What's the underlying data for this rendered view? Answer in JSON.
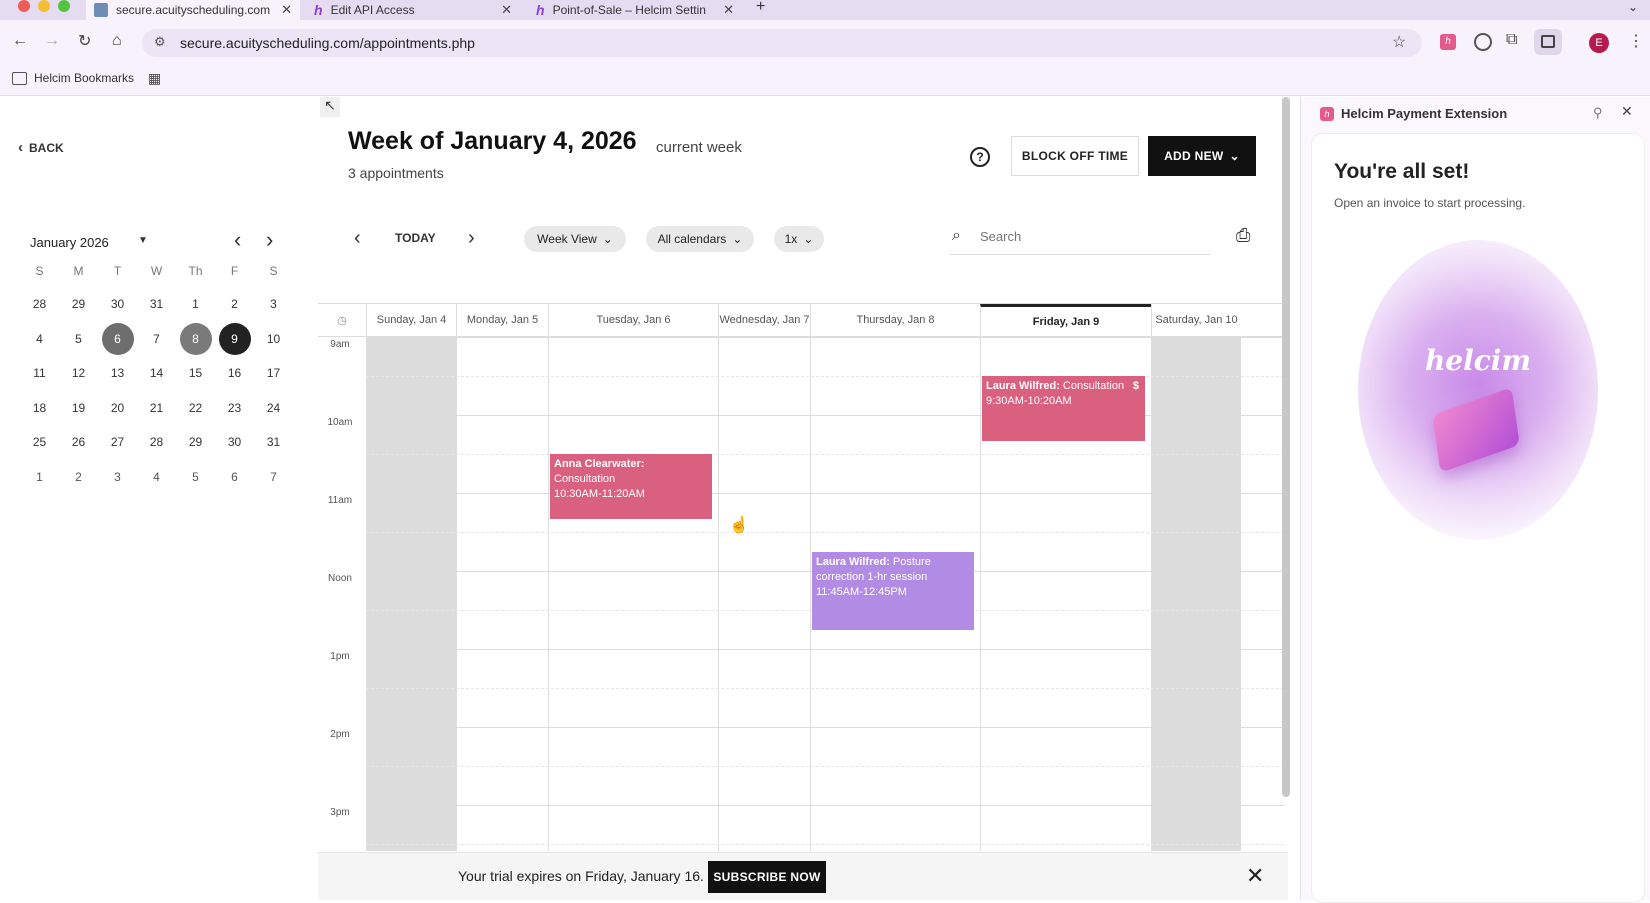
{
  "browser": {
    "tabs": [
      {
        "title": "secure.acuityscheduling.com",
        "active": true
      },
      {
        "title": "Edit API Access",
        "active": false
      },
      {
        "title": "Point-of-Sale – Helcim Settin",
        "active": false
      }
    ],
    "url": "secure.acuityscheduling.com/appointments.php",
    "bookmarks": [
      {
        "label": "Helcim Bookmarks"
      }
    ],
    "profile_initial": "E"
  },
  "leftpane": {
    "back_label": "BACK",
    "month_label": "January 2026",
    "weekdays": [
      "S",
      "M",
      "T",
      "W",
      "Th",
      "F",
      "S"
    ],
    "weeks": [
      [
        "28",
        "29",
        "30",
        "31",
        "1",
        "2",
        "3"
      ],
      [
        "4",
        "5",
        "6",
        "7",
        "8",
        "9",
        "10"
      ],
      [
        "11",
        "12",
        "13",
        "14",
        "15",
        "16",
        "17"
      ],
      [
        "18",
        "19",
        "20",
        "21",
        "22",
        "23",
        "24"
      ],
      [
        "25",
        "26",
        "27",
        "28",
        "29",
        "30",
        "31"
      ],
      [
        "1",
        "2",
        "3",
        "4",
        "5",
        "6",
        "7"
      ]
    ]
  },
  "header": {
    "title": "Week of January 4, 2026",
    "subtitle_tag": "current week",
    "appt_count": "3 appointments",
    "block_off": "BLOCK OFF TIME",
    "add_new": "ADD NEW"
  },
  "toolbar": {
    "today": "TODAY",
    "view": "Week View",
    "calendars": "All calendars",
    "zoom": "1x",
    "search_placeholder": "Search"
  },
  "calendar": {
    "days": [
      {
        "label": "Sunday, Jan 4",
        "shaded": true
      },
      {
        "label": "Monday, Jan 5",
        "shaded": false
      },
      {
        "label": "Tuesday, Jan 6",
        "shaded": false
      },
      {
        "label": "Wednesday, Jan 7",
        "shaded": false
      },
      {
        "label": "Thursday, Jan 8",
        "shaded": false
      },
      {
        "label": "Friday, Jan 9",
        "shaded": false,
        "current": true
      },
      {
        "label": "Saturday, Jan 10",
        "shaded": true
      }
    ],
    "times": [
      "9am",
      "10am",
      "11am",
      "Noon",
      "1pm",
      "2pm",
      "3pm"
    ],
    "appointments": [
      {
        "name": "Anna Clearwater:",
        "service": "Consultation",
        "time": "10:30AM-11:20AM",
        "day": "Tuesday, Jan 6",
        "color": "#d9607e"
      },
      {
        "name": "Laura Wilfred:",
        "service": "Posture correction 1-hr session",
        "time": "11:45AM-12:45PM",
        "day": "Thursday, Jan 8",
        "color": "#b28be5"
      },
      {
        "name": "Laura Wilfred:",
        "service": "Consultation",
        "badge": "$",
        "time": "9:30AM-10:20AM",
        "day": "Friday, Jan 9",
        "color": "#d9607e"
      }
    ]
  },
  "trial": {
    "message": "Your trial expires on Friday, January 16.",
    "cta": "SUBSCRIBE NOW"
  },
  "extension": {
    "title": "Helcim Payment Extension",
    "heading": "You're all set!",
    "subtext": "Open an invoice to start processing.",
    "logo_text": "helcim"
  },
  "colors": {
    "accent": "#111111",
    "appt_pink": "#d9607e",
    "appt_purple": "#b28be5"
  }
}
